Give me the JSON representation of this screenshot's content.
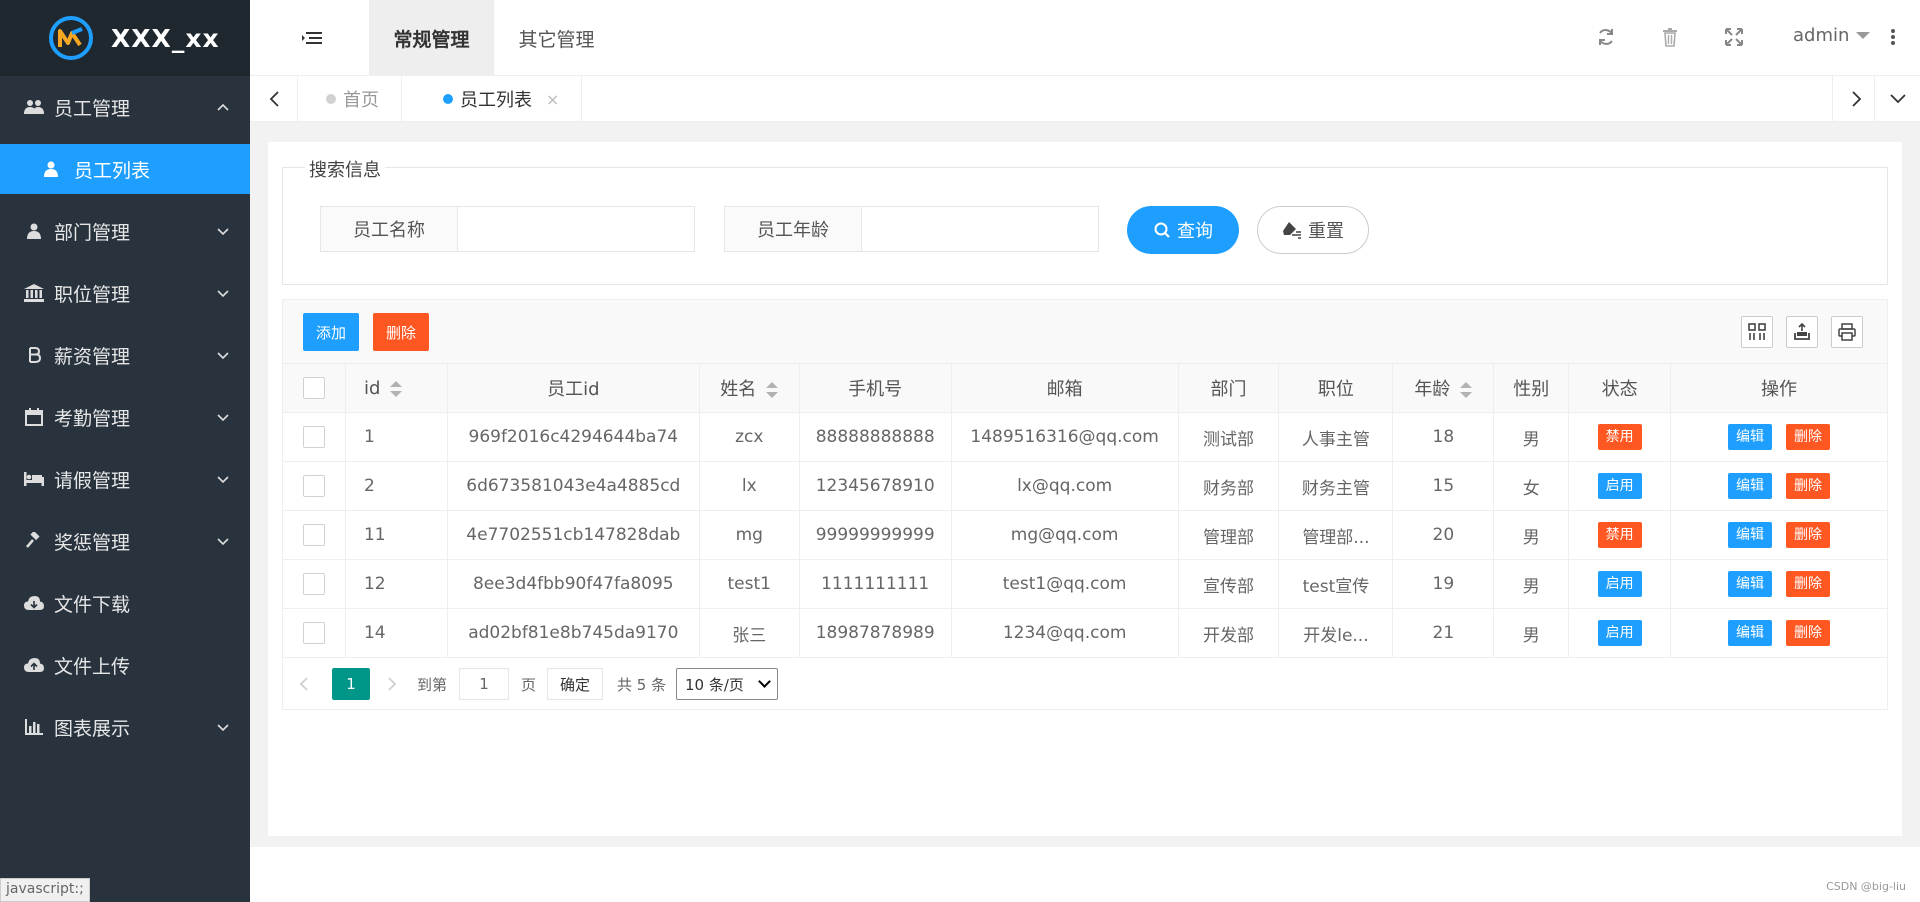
{
  "app": {
    "title": "XXX_xx"
  },
  "sidebar": {
    "items": [
      {
        "label": "员工管理",
        "icon": "users-icon",
        "expanded": true
      },
      {
        "label": "部门管理",
        "icon": "user-icon"
      },
      {
        "label": "职位管理",
        "icon": "bank-icon"
      },
      {
        "label": "薪资管理",
        "icon": "bitcoin-icon"
      },
      {
        "label": "考勤管理",
        "icon": "calendar-icon"
      },
      {
        "label": "请假管理",
        "icon": "bed-icon"
      },
      {
        "label": "奖惩管理",
        "icon": "gavel-icon"
      },
      {
        "label": "文件下载",
        "icon": "cloud-download-icon"
      },
      {
        "label": "文件上传",
        "icon": "cloud-upload-icon"
      },
      {
        "label": "图表展示",
        "icon": "bar-chart-icon"
      }
    ],
    "subitem": {
      "label": "员工列表"
    }
  },
  "header": {
    "tabs": [
      "常规管理",
      "其它管理"
    ],
    "user": "admin"
  },
  "tabbar": {
    "tabs": [
      {
        "label": "首页"
      },
      {
        "label": "员工列表",
        "close": "×"
      }
    ]
  },
  "search": {
    "legend": "搜索信息",
    "name_label": "员工名称",
    "age_label": "员工年龄",
    "name_value": "",
    "age_value": "",
    "query_label": "查询",
    "reset_label": "重置"
  },
  "toolbar": {
    "add_label": "添加",
    "delete_label": "删除"
  },
  "table": {
    "columns": [
      "id",
      "员工id",
      "姓名",
      "手机号",
      "邮箱",
      "部门",
      "职位",
      "年龄",
      "性别",
      "状态",
      "操作"
    ],
    "rows": [
      {
        "id": "1",
        "eid": "969f2016c4294644ba74",
        "name": "zcx",
        "phone": "88888888888",
        "email": "1489516316@qq.com",
        "dept": "测试部",
        "pos": "人事主管",
        "age": "18",
        "gender": "男",
        "status": "禁用"
      },
      {
        "id": "2",
        "eid": "6d673581043e4a4885cd",
        "name": "lx",
        "phone": "12345678910",
        "email": "lx@qq.com",
        "dept": "财务部",
        "pos": "财务主管",
        "age": "15",
        "gender": "女",
        "status": "启用"
      },
      {
        "id": "11",
        "eid": "4e7702551cb147828dab",
        "name": "mg",
        "phone": "99999999999",
        "email": "mg@qq.com",
        "dept": "管理部",
        "pos": "管理部...",
        "age": "20",
        "gender": "男",
        "status": "禁用"
      },
      {
        "id": "12",
        "eid": "8ee3d4fbb90f47fa8095",
        "name": "test1",
        "phone": "1111111111",
        "email": "test1@qq.com",
        "dept": "宣传部",
        "pos": "test宣传",
        "age": "19",
        "gender": "男",
        "status": "启用"
      },
      {
        "id": "14",
        "eid": "ad02bf81e8b745da9170",
        "name": "张三",
        "phone": "18987878989",
        "email": "1234@qq.com",
        "dept": "开发部",
        "pos": "开发le...",
        "age": "21",
        "gender": "男",
        "status": "启用"
      }
    ],
    "edit_label": "编辑",
    "delete_label": "删除"
  },
  "pager": {
    "current": "1",
    "goto_label": "到第",
    "goto_value": "1",
    "page_unit": "页",
    "confirm_label": "确定",
    "total_label": "共 5 条",
    "page_size": "10 条/页"
  },
  "statusbar": {
    "text": "javascript:;"
  },
  "credit": "CSDN @big-liu",
  "colors": {
    "accent": "#1E9FFF",
    "danger": "#FF5722",
    "sidebar": "#28333E",
    "pager_active": "#009688"
  }
}
